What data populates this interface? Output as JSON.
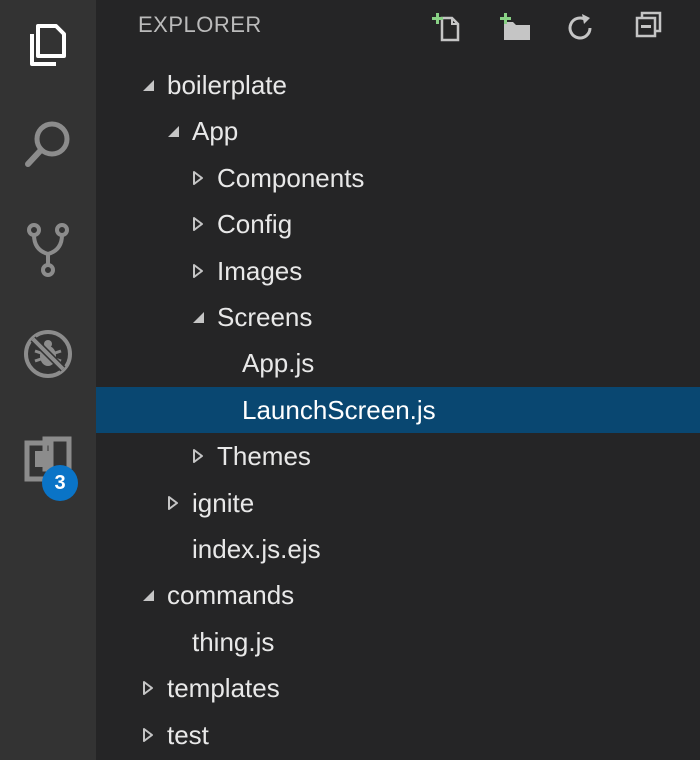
{
  "explorer": {
    "title": "EXPLORER",
    "actions": [
      "new-file-icon",
      "new-folder-icon",
      "refresh-icon",
      "collapse-all-icon"
    ]
  },
  "activity_bar": {
    "items": [
      "explorer-icon",
      "search-icon",
      "source-control-icon",
      "debug-icon",
      "extensions-icon"
    ],
    "extensions_badge": "3"
  },
  "tree": [
    {
      "label": "boilerplate",
      "type": "folder",
      "state": "expanded",
      "depth": 0
    },
    {
      "label": "App",
      "type": "folder",
      "state": "expanded",
      "depth": 1
    },
    {
      "label": "Components",
      "type": "folder",
      "state": "collapsed",
      "depth": 2
    },
    {
      "label": "Config",
      "type": "folder",
      "state": "collapsed",
      "depth": 2
    },
    {
      "label": "Images",
      "type": "folder",
      "state": "collapsed",
      "depth": 2
    },
    {
      "label": "Screens",
      "type": "folder",
      "state": "expanded",
      "depth": 2
    },
    {
      "label": "App.js",
      "type": "file",
      "depth": 3
    },
    {
      "label": "LaunchScreen.js",
      "type": "file",
      "depth": 3,
      "selected": true
    },
    {
      "label": "Themes",
      "type": "folder",
      "state": "collapsed",
      "depth": 2
    },
    {
      "label": "ignite",
      "type": "folder",
      "state": "collapsed",
      "depth": 1
    },
    {
      "label": "index.js.ejs",
      "type": "file",
      "depth": 1
    },
    {
      "label": "commands",
      "type": "folder",
      "state": "expanded",
      "depth": 0
    },
    {
      "label": "thing.js",
      "type": "file",
      "depth": 1
    },
    {
      "label": "templates",
      "type": "folder",
      "state": "collapsed",
      "depth": 0
    },
    {
      "label": "test",
      "type": "folder",
      "state": "collapsed",
      "depth": 0
    }
  ],
  "colors": {
    "activity_bar": "#333333",
    "sidebar": "#252526",
    "selection": "#094771",
    "badge": "#0a74c7",
    "add_plus": "#89d185"
  }
}
